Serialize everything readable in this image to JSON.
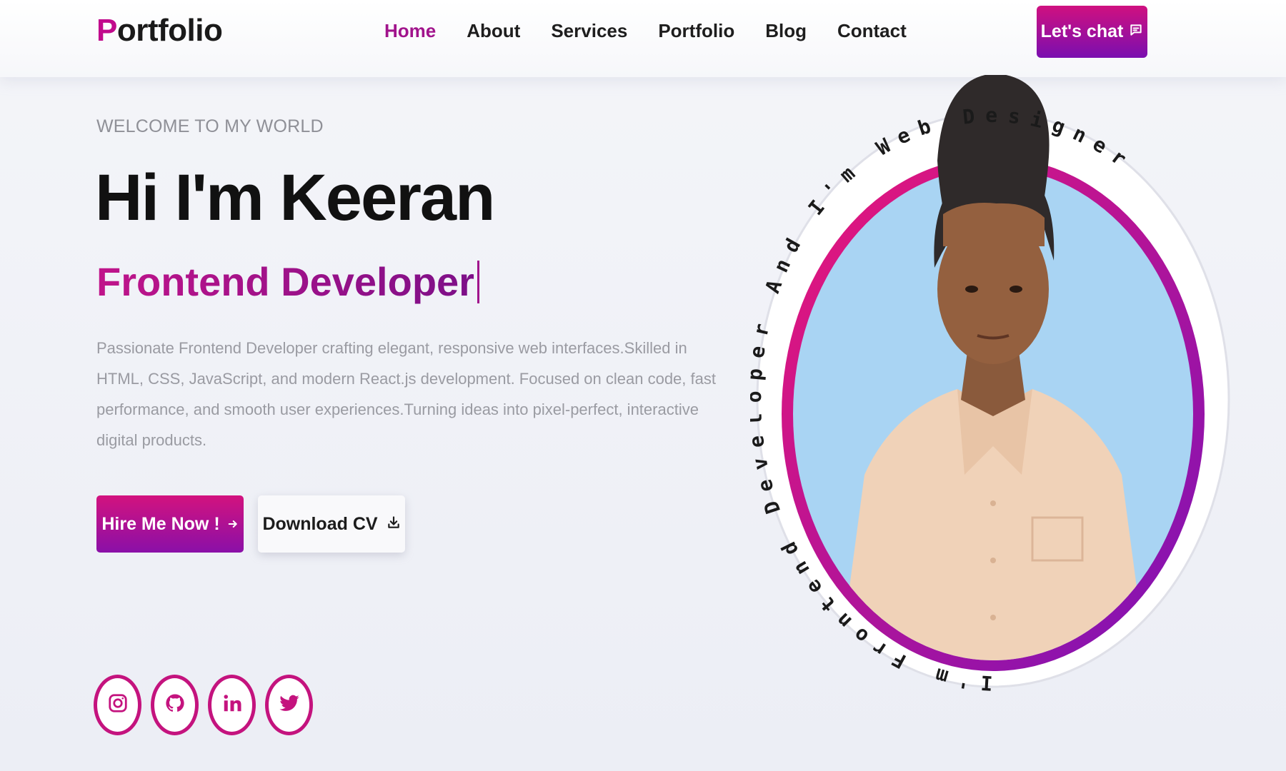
{
  "header": {
    "logo_initial": "P",
    "logo_rest": "ortfolio",
    "nav": [
      "Home",
      "About",
      "Services",
      "Portfolio",
      "Blog",
      "Contact"
    ],
    "active_nav": "Home",
    "chat_label": "Let's chat",
    "chat_icon": "message-square-icon"
  },
  "hero": {
    "welcome": "WELCOME TO MY WORLD",
    "title": "Hi I'm Keeran",
    "role": "Frontend Developer",
    "description": "Passionate Frontend Developer crafting elegant, responsive web interfaces.Skilled in HTML, CSS, JavaScript, and modern React.js development. Focused on clean code, fast performance, and smooth user experiences.Turning ideas into pixel-perfect, interactive digital products.",
    "hire_label": "Hire Me Now !",
    "hire_icon": "arrow-right-icon",
    "cv_label": "Download CV",
    "cv_icon": "download-icon"
  },
  "socials": [
    "instagram-icon",
    "github-icon",
    "linkedin-icon",
    "twitter-icon"
  ],
  "portrait": {
    "ring_text": "I'm Frontend Developer And I'm Web Designer",
    "background_color": "#a9d4f3",
    "ring_gradient": [
      "#ec1677",
      "#7a12b8"
    ]
  }
}
